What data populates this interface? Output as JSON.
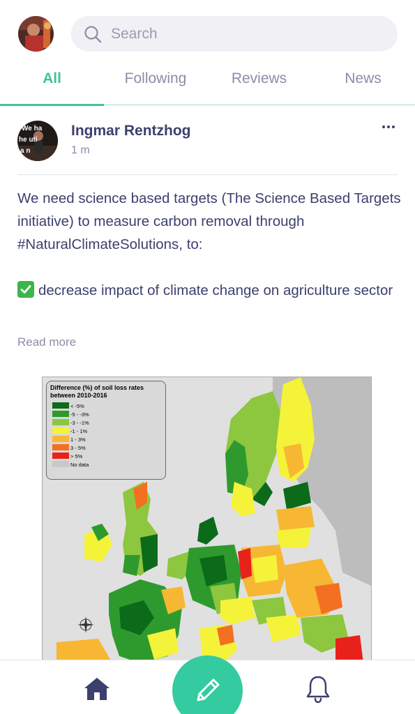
{
  "search": {
    "placeholder": "Search"
  },
  "tabs": [
    {
      "label": "All",
      "active": true
    },
    {
      "label": "Following",
      "active": false
    },
    {
      "label": "Reviews",
      "active": false
    },
    {
      "label": "News",
      "active": false
    }
  ],
  "post": {
    "author": "Ingmar Rentzhog",
    "time": "1 m",
    "text_paragraph_1": "We need science based targets (The Science Based Targets initiative) to measure carbon removal through #NaturalClimateSolutions, to:",
    "text_paragraph_2": "decrease impact of climate change on agriculture sector",
    "read_more": "Read more",
    "author_avatar_text": "We ha he utu al n"
  },
  "map": {
    "legend_title": "Difference (%) of soil loss rates between 2010-2016",
    "legend_items": [
      {
        "label": "< -5%",
        "color": "#0b6b1a"
      },
      {
        "label": "-5 - -3%",
        "color": "#2e9a2e"
      },
      {
        "label": "-3 - -1%",
        "color": "#8dc63f"
      },
      {
        "label": "-1 - 1%",
        "color": "#f5f23a"
      },
      {
        "label": "1 - 3%",
        "color": "#f7b733"
      },
      {
        "label": "3 - 5%",
        "color": "#f37021"
      },
      {
        "label": "> 5%",
        "color": "#e8221b"
      },
      {
        "label": "No data",
        "color": "#c8c8c8"
      }
    ]
  },
  "colors": {
    "accent": "#3fc499",
    "text": "#3d3f6e",
    "muted": "#8b8da7",
    "compose": "#34cba0"
  },
  "icons": {
    "search": "search-icon",
    "more": "more-icon",
    "check": "check-mark-icon",
    "home": "home-icon",
    "compose": "pencil-icon",
    "notifications": "bell-icon"
  }
}
